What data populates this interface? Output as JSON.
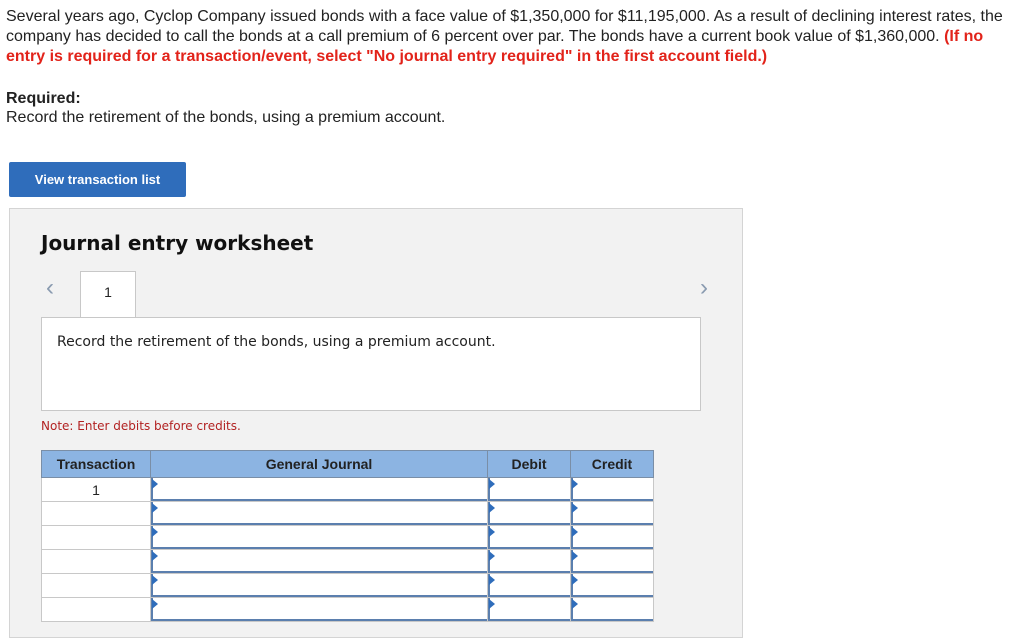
{
  "problem": {
    "text": "Several years ago, Cyclop Company issued bonds with a face value of $1,350,000 for $11,195,000. As a result of declining interest rates, the company has decided to call the bonds at a call premium of 6 percent over par. The bonds have a current book value of $1,360,000.",
    "warning": "(If no entry is required for a transaction/event, select \"No journal entry required\" in the first account field.)"
  },
  "required": {
    "heading": "Required:",
    "text": "Record the retirement of the bonds, using a premium account."
  },
  "buttons": {
    "view_transaction_list": "View transaction list"
  },
  "worksheet": {
    "title": "Journal entry worksheet",
    "tab_label": "1",
    "prev_icon": "chevron-left-icon",
    "next_icon": "chevron-right-icon",
    "description": "Record the retirement of the bonds, using a premium account.",
    "note": "Note: Enter debits before credits."
  },
  "table": {
    "headers": [
      "Transaction",
      "General Journal",
      "Debit",
      "Credit"
    ],
    "rows": [
      {
        "transaction": "1",
        "account": "",
        "debit": "",
        "credit": ""
      },
      {
        "transaction": "",
        "account": "",
        "debit": "",
        "credit": ""
      },
      {
        "transaction": "",
        "account": "",
        "debit": "",
        "credit": ""
      },
      {
        "transaction": "",
        "account": "",
        "debit": "",
        "credit": ""
      },
      {
        "transaction": "",
        "account": "",
        "debit": "",
        "credit": ""
      },
      {
        "transaction": "",
        "account": "",
        "debit": "",
        "credit": ""
      }
    ]
  },
  "colors": {
    "warning": "#e2231a",
    "button": "#2f6dbb",
    "header": "#8cb4e2",
    "note": "#b22222"
  }
}
